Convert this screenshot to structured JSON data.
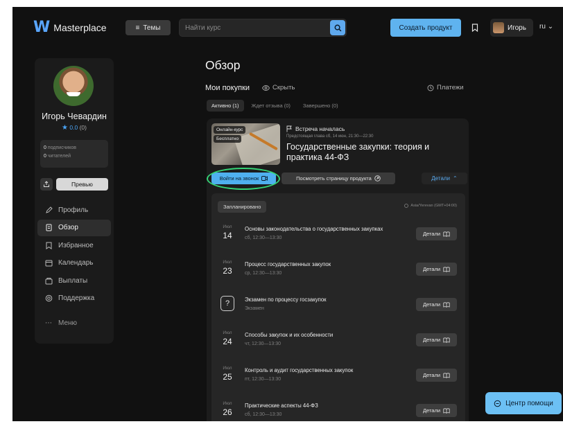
{
  "header": {
    "brand": "Masterplace",
    "themes_label": "Темы",
    "search_placeholder": "Найти курс",
    "create_label": "Создать продукт",
    "user_name": "Игорь",
    "language": "ru"
  },
  "profile": {
    "name": "Игорь Чевардин",
    "rating": "0.0",
    "reviews": "(0)",
    "subscribers_count": "0",
    "subscribers_label": "подписчиков",
    "readers_count": "0",
    "readers_label": "читателей",
    "preview_label": "Превью"
  },
  "nav": {
    "items": [
      {
        "label": "Профиль",
        "icon": "pencil-icon"
      },
      {
        "label": "Обзор",
        "icon": "overview-icon"
      },
      {
        "label": "Избранное",
        "icon": "bookmark-icon"
      },
      {
        "label": "Календарь",
        "icon": "calendar-icon"
      },
      {
        "label": "Выплаты",
        "icon": "wallet-icon"
      },
      {
        "label": "Поддержка",
        "icon": "support-icon"
      }
    ],
    "menu_label": "Меню"
  },
  "main": {
    "title": "Обзор",
    "purchases_title": "Мои покупки",
    "hide_label": "Скрыть",
    "payments_label": "Платежи",
    "tabs": [
      {
        "label": "Активно (1)"
      },
      {
        "label": "Ждет отзыва (0)"
      },
      {
        "label": "Завершено (0)"
      }
    ]
  },
  "course": {
    "badge_type": "Онлайн-курс",
    "badge_price": "Бесплатно",
    "meeting_status": "Встреча началась",
    "presenter_line": "Предстоящая глава сб, 14 июн, 21:30—22:30",
    "title": "Государственные закупки: теория и практика 44-ФЗ",
    "join_label": "Войти на звонок",
    "view_label": "Посмотреть страницу продукта",
    "details_label": "Детали"
  },
  "schedule": {
    "planned_label": "Запланировано",
    "timezone": "Asia/Yerevan (GMT+04:00)",
    "details_label": "Детали",
    "items": [
      {
        "month": "Июл",
        "day": "14",
        "title": "Основы законодательства о государственных закупках",
        "subtitle": "сб, 12:30—13:30"
      },
      {
        "month": "Июл",
        "day": "23",
        "title": "Процесс государственных закупок",
        "subtitle": "ср, 12:30—13:30"
      },
      {
        "month": "",
        "day": "",
        "title": "Экзамен по процессу госзакупок",
        "subtitle": "Экзамен",
        "is_exam": true
      },
      {
        "month": "Июл",
        "day": "24",
        "title": "Способы закупок и их особенности",
        "subtitle": "чт, 12:30—13:30"
      },
      {
        "month": "Июл",
        "day": "25",
        "title": "Контроль и аудит государственных закупок",
        "subtitle": "пт, 12:30—13:30"
      },
      {
        "month": "Июл",
        "day": "26",
        "title": "Практические аспекты 44-ФЗ",
        "subtitle": "сб, 12:30—13:30"
      }
    ]
  },
  "help": {
    "label": "Центр помощи"
  },
  "colors": {
    "accent": "#5fb3ef",
    "highlight_ring": "#35d476",
    "background": "#111111"
  }
}
